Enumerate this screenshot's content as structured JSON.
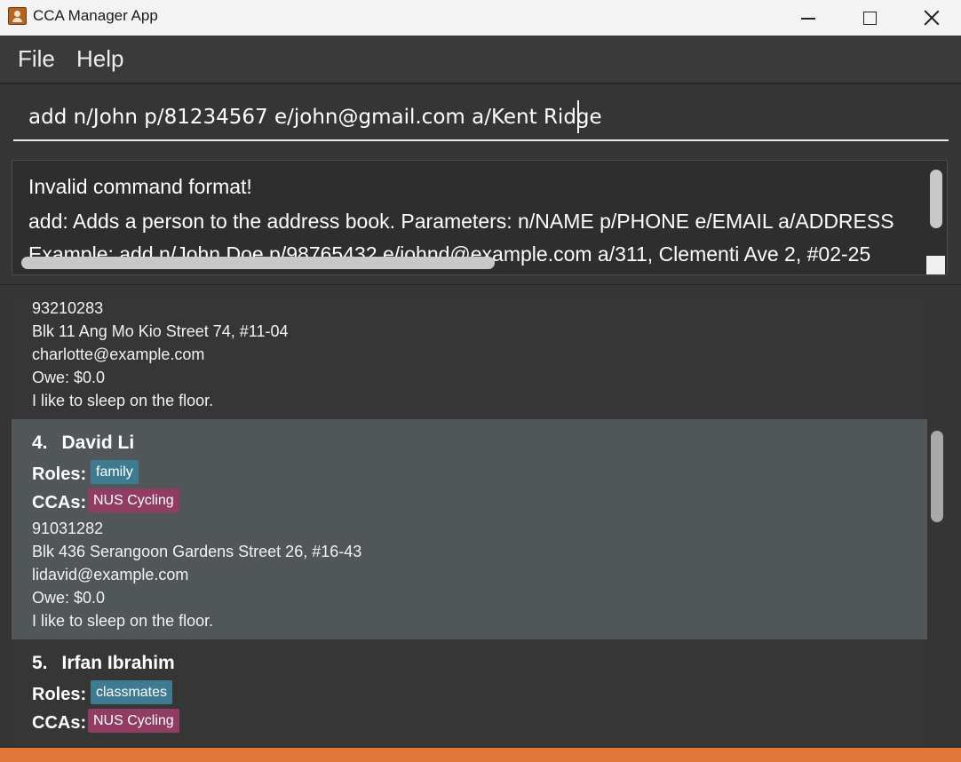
{
  "window": {
    "title": "CCA Manager App"
  },
  "menu": {
    "file_label": "File",
    "help_label": "Help"
  },
  "command": {
    "value": "add n/John p/81234567 e/john@gmail.com a/Kent Ridge"
  },
  "result": {
    "lines": [
      "Invalid command format!",
      "add: Adds a person to the address book. Parameters: n/NAME p/PHONE e/EMAIL a/ADDRESS",
      "Example: add n/John Doe p/98765432 e/johnd@example.com a/311, Clementi Ave 2, #02-25"
    ]
  },
  "persons": {
    "labels": {
      "roles": "Roles:",
      "ccas": "CCAs:"
    },
    "partial": {
      "phone": "93210283",
      "address": "Blk 11 Ang Mo Kio Street 74, #11-04",
      "email": "charlotte@example.com",
      "owe": "Owe: $0.0",
      "remark": "I like to sleep on the floor."
    },
    "david": {
      "index": "4.",
      "name": "David Li",
      "role": "family",
      "cca": "NUS Cycling",
      "phone": "91031282",
      "address": "Blk 436 Serangoon Gardens Street 26, #16-43",
      "email": "lidavid@example.com",
      "owe": "Owe: $0.0",
      "remark": "I like to sleep on the floor."
    },
    "irfan": {
      "index": "5.",
      "name": "Irfan Ibrahim",
      "role": "classmates",
      "cca": "NUS Cycling"
    }
  },
  "colors": {
    "role_tag": "#3e7b91",
    "cca_tag": "#913c63",
    "selected_card": "#515658",
    "status_accent": "#e1773a"
  },
  "icons": {
    "app": "contact-book-icon",
    "minimize": "minimize-icon",
    "maximize": "maximize-icon",
    "close": "close-icon"
  }
}
